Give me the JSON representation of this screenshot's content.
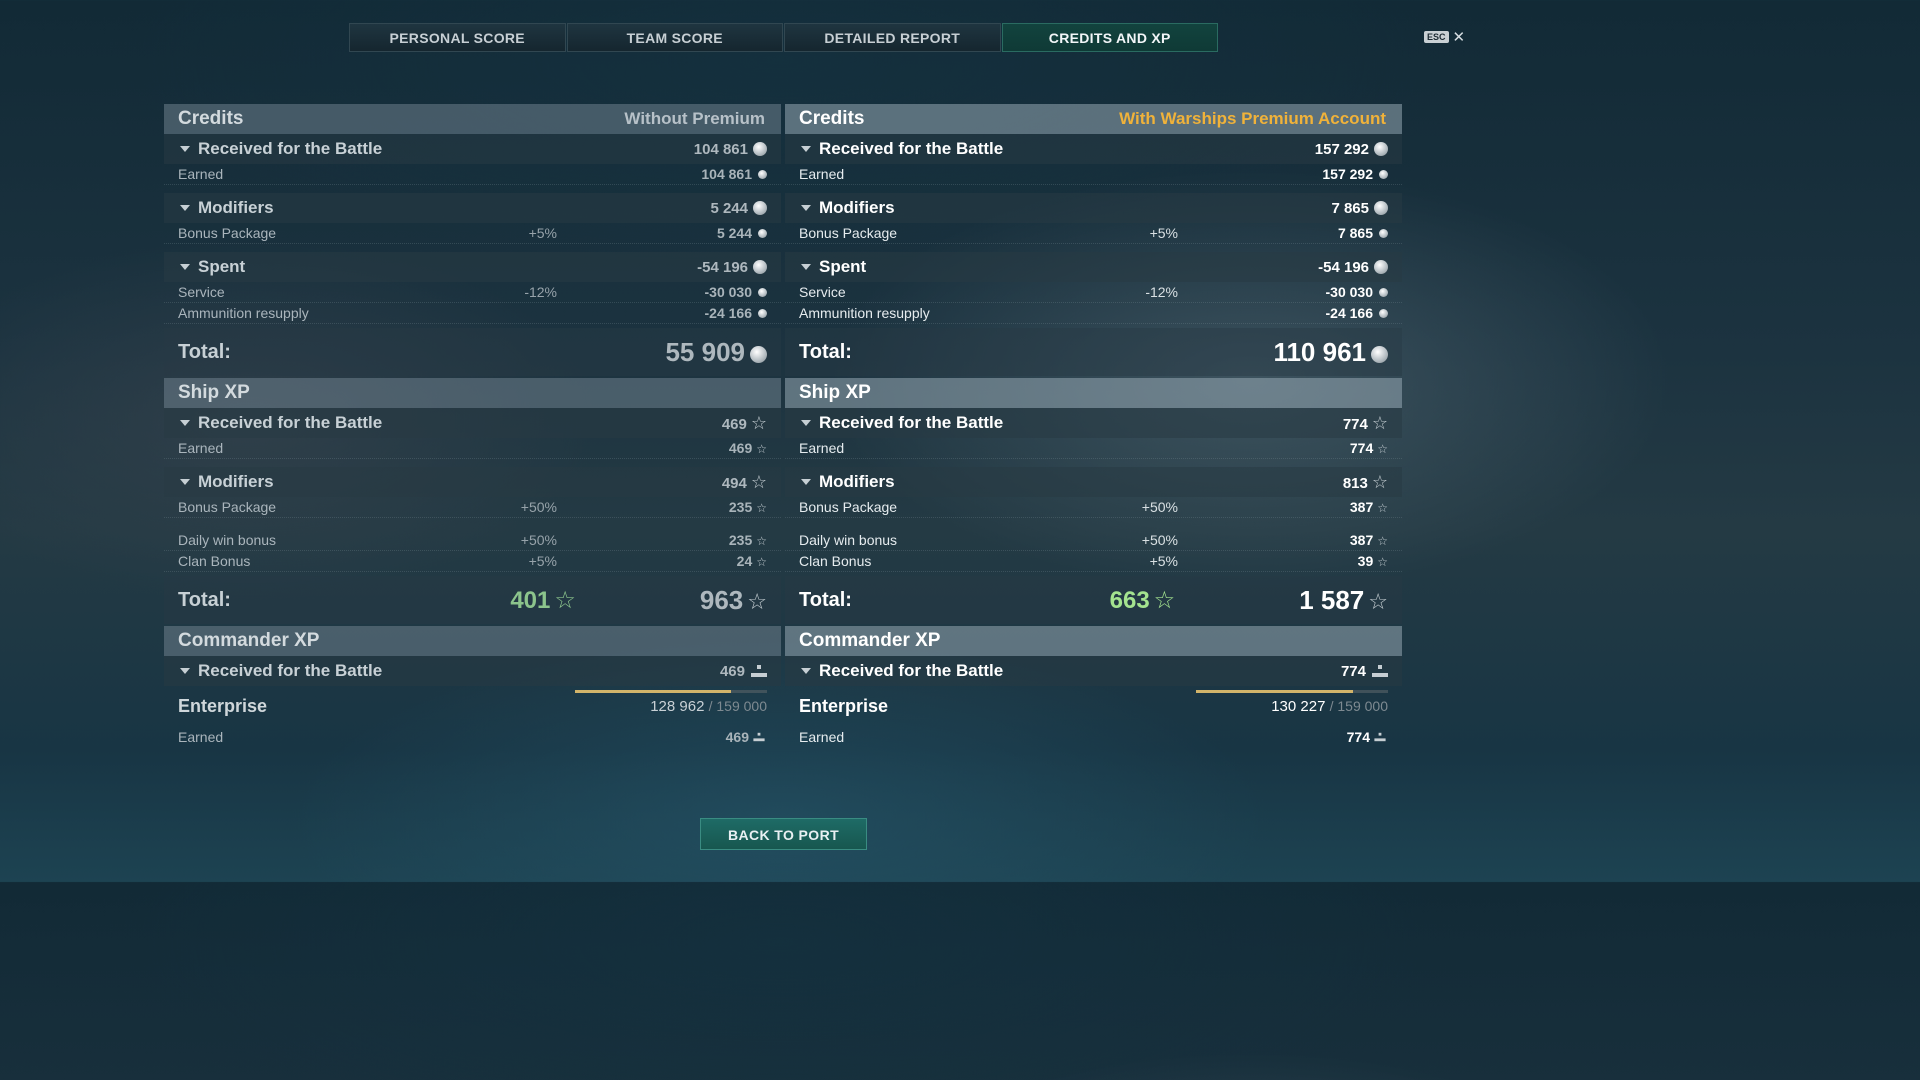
{
  "tabs": [
    "PERSONAL SCORE",
    "TEAM SCORE",
    "DETAILED REPORT",
    "CREDITS AND XP"
  ],
  "active_tab": 3,
  "esc_label": "ESC",
  "close_glyph": "✕",
  "back_button": "BACK TO PORT",
  "left": {
    "credits": {
      "title": "Credits",
      "subtitle": "Without Premium",
      "received": {
        "label": "Received for the Battle",
        "value": "104 861"
      },
      "earned": {
        "label": "Earned",
        "value": "104 861"
      },
      "modifiers": {
        "label": "Modifiers",
        "value": "5 244"
      },
      "bonus_package": {
        "label": "Bonus Package",
        "pct": "+5%",
        "value": "5 244"
      },
      "spent": {
        "label": "Spent",
        "value": "-54 196"
      },
      "service": {
        "label": "Service",
        "pct": "-12%",
        "value": "-30 030"
      },
      "ammo": {
        "label": "Ammunition resupply",
        "value": "-24 166"
      },
      "total": {
        "label": "Total:",
        "value": "55 909"
      }
    },
    "ship_xp": {
      "title": "Ship XP",
      "received": {
        "label": "Received for the Battle",
        "value": "469"
      },
      "earned": {
        "label": "Earned",
        "value": "469"
      },
      "modifiers": {
        "label": "Modifiers",
        "value": "494"
      },
      "bonus_package": {
        "label": "Bonus Package",
        "pct": "+50%",
        "value": "235"
      },
      "daily_win": {
        "label": "Daily win bonus",
        "pct": "+50%",
        "value": "235"
      },
      "clan_bonus": {
        "label": "Clan Bonus",
        "pct": "+5%",
        "value": "24"
      },
      "total": {
        "label": "Total:",
        "green": "401",
        "value": "963"
      }
    },
    "commander_xp": {
      "title": "Commander XP",
      "received": {
        "label": "Received for the Battle",
        "value": "469"
      },
      "commander": {
        "name": "Enterprise",
        "current": "128 962",
        "max": "/ 159 000",
        "progress": 0.811
      },
      "earned": {
        "label": "Earned",
        "value": "469"
      }
    }
  },
  "right": {
    "credits": {
      "title": "Credits",
      "subtitle": "With Warships Premium Account",
      "received": {
        "label": "Received for the Battle",
        "value": "157 292"
      },
      "earned": {
        "label": "Earned",
        "value": "157 292"
      },
      "modifiers": {
        "label": "Modifiers",
        "value": "7 865"
      },
      "bonus_package": {
        "label": "Bonus Package",
        "pct": "+5%",
        "value": "7 865"
      },
      "spent": {
        "label": "Spent",
        "value": "-54 196"
      },
      "service": {
        "label": "Service",
        "pct": "-12%",
        "value": "-30 030"
      },
      "ammo": {
        "label": "Ammunition resupply",
        "value": "-24 166"
      },
      "total": {
        "label": "Total:",
        "value": "110 961"
      }
    },
    "ship_xp": {
      "title": "Ship XP",
      "received": {
        "label": "Received for the Battle",
        "value": "774"
      },
      "earned": {
        "label": "Earned",
        "value": "774"
      },
      "modifiers": {
        "label": "Modifiers",
        "value": "813"
      },
      "bonus_package": {
        "label": "Bonus Package",
        "pct": "+50%",
        "value": "387"
      },
      "daily_win": {
        "label": "Daily win bonus",
        "pct": "+50%",
        "value": "387"
      },
      "clan_bonus": {
        "label": "Clan Bonus",
        "pct": "+5%",
        "value": "39"
      },
      "total": {
        "label": "Total:",
        "green": "663",
        "value": "1 587"
      }
    },
    "commander_xp": {
      "title": "Commander XP",
      "received": {
        "label": "Received for the Battle",
        "value": "774"
      },
      "commander": {
        "name": "Enterprise",
        "current": "130 227",
        "max": "/ 159 000",
        "progress": 0.819
      },
      "earned": {
        "label": "Earned",
        "value": "774"
      }
    }
  },
  "colors": {
    "premium": "#f0b23a",
    "free_xp_green": "#8cc48c",
    "active_tab": "#12433e",
    "button": "#1e6b66"
  },
  "icons": {
    "credits": "silver-coin-icon",
    "xp": "star-icon",
    "commander_xp": "commander-xp-icon"
  }
}
